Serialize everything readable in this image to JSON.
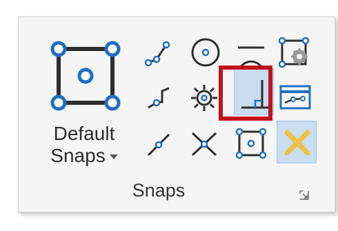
{
  "ribbon": {
    "group_label": "Snaps",
    "default_snaps": {
      "line1": "Default",
      "line2": "Snaps",
      "icon": "default-snap-icon"
    },
    "snap_buttons": [
      {
        "icon": "keypoint-snap-icon"
      },
      {
        "icon": "center-snap-icon"
      },
      {
        "icon": "tangent-snap-icon"
      },
      {
        "icon": "snap-settings-icon"
      },
      {
        "icon": "origin-snap-icon"
      },
      {
        "icon": "intersection-point-snap-icon"
      },
      {
        "icon": "perpendicular-snap-icon",
        "highlighted": true
      },
      {
        "icon": "snap-mode-toolbar-icon"
      },
      {
        "icon": "nearest-snap-icon"
      },
      {
        "icon": "intersection-snap-icon"
      },
      {
        "icon": "midpoint-snap-icon"
      },
      {
        "icon": "snaps-off-icon",
        "active": true
      }
    ],
    "dialog_launcher_icon": "dialog-launcher-icon",
    "colors": {
      "accent": "#1e6fc2",
      "highlight_frame": "#c1121c",
      "active_bg": "#c9ddf0",
      "snaps_off": "#f0c040"
    }
  }
}
